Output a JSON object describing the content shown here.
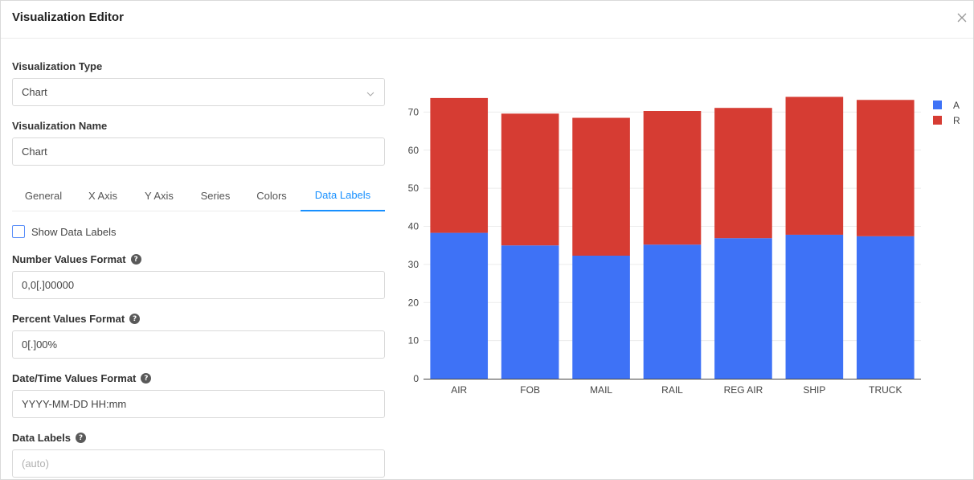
{
  "header": {
    "title": "Visualization Editor"
  },
  "form": {
    "type_label": "Visualization Type",
    "type_value": "Chart",
    "name_label": "Visualization Name",
    "name_value": "Chart"
  },
  "tabs": [
    {
      "label": "General"
    },
    {
      "label": "X Axis"
    },
    {
      "label": "Y Axis"
    },
    {
      "label": "Series"
    },
    {
      "label": "Colors"
    },
    {
      "label": "Data Labels",
      "active": true
    }
  ],
  "data_labels": {
    "show_label": "Show Data Labels",
    "show_checked": false,
    "number_format_label": "Number Values Format",
    "number_format_value": "0,0[.]00000",
    "percent_format_label": "Percent Values Format",
    "percent_format_value": "0[.]00%",
    "datetime_format_label": "Date/Time Values Format",
    "datetime_format_value": "YYYY-MM-DD HH:mm",
    "data_labels_label": "Data Labels",
    "data_labels_placeholder": "(auto)"
  },
  "icons": {
    "close": "close-icon",
    "select_arrow": "chevron-down-icon",
    "help": "question-circle-icon",
    "help_glyph": "?"
  },
  "colors": {
    "series_a": "#3e72f6",
    "series_r": "#d63c33",
    "accent": "#1890ff"
  },
  "chart_data": {
    "type": "bar",
    "stacked": true,
    "categories": [
      "AIR",
      "FOB",
      "MAIL",
      "RAIL",
      "REG AIR",
      "SHIP",
      "TRUCK"
    ],
    "series": [
      {
        "name": "A",
        "values": [
          38.3,
          35.0,
          32.3,
          35.2,
          36.9,
          37.8,
          37.4
        ]
      },
      {
        "name": "R",
        "values": [
          35.4,
          34.6,
          36.2,
          35.1,
          34.2,
          36.2,
          35.8
        ]
      }
    ],
    "yticks": [
      0,
      10,
      20,
      30,
      40,
      50,
      60,
      70
    ],
    "ylim": [
      0,
      76
    ],
    "grid": true,
    "legend_position": "top-right"
  }
}
